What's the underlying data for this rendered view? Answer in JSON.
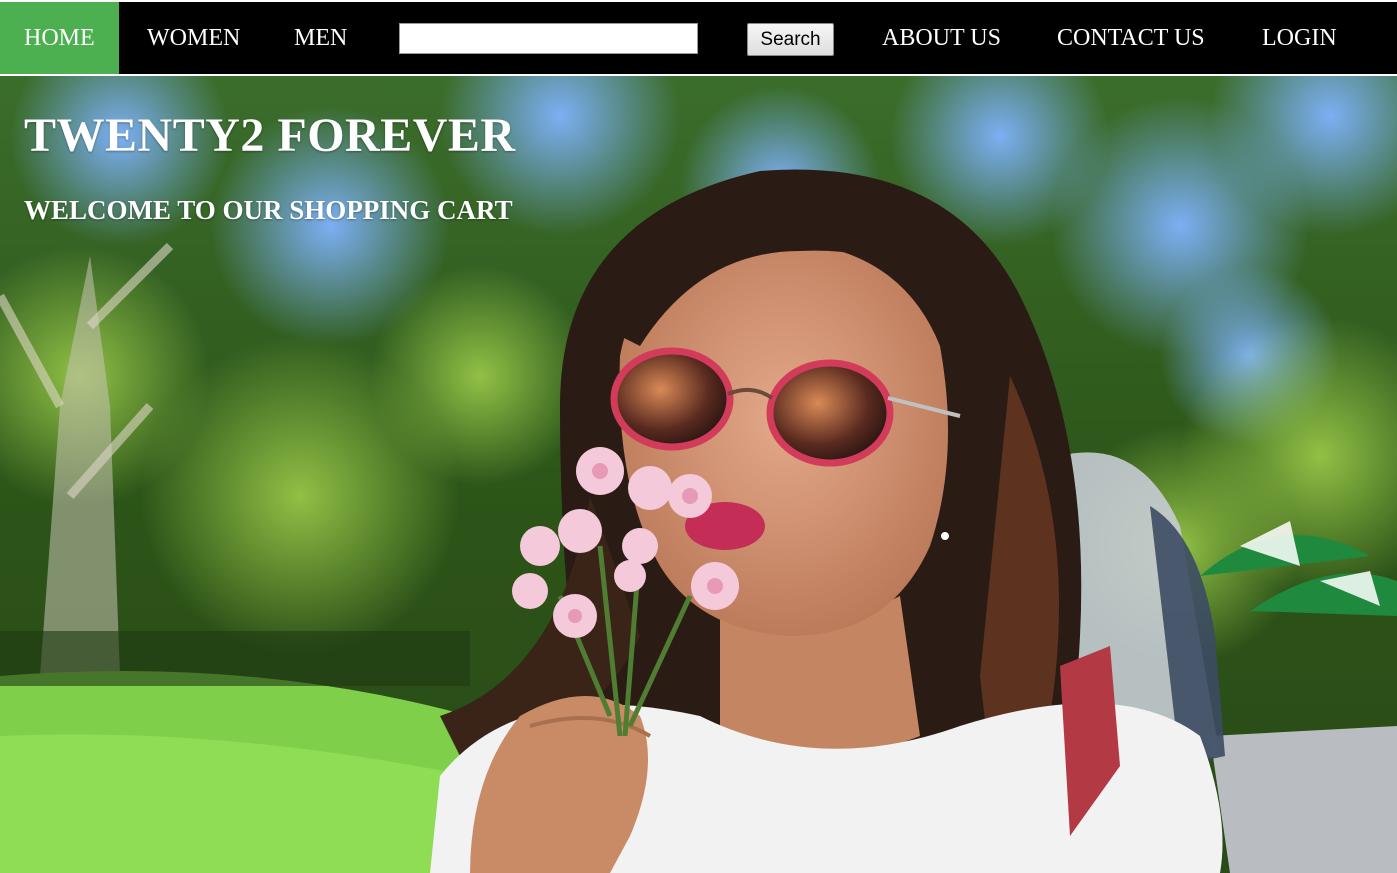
{
  "nav": {
    "home": "HOME",
    "women": "WOMEN",
    "men": "MEN",
    "search_value": "",
    "search_button": "Search",
    "about": "ABOUT US",
    "contact": "CONTACT US",
    "login": "LOGIN"
  },
  "hero": {
    "title": "TWENTY2 FOREVER",
    "subtitle": "WELCOME TO OUR SHOPPING CART"
  },
  "colors": {
    "navbar_bg": "#000000",
    "active_tab_bg": "#4caf50",
    "nav_text": "#ffffff"
  }
}
